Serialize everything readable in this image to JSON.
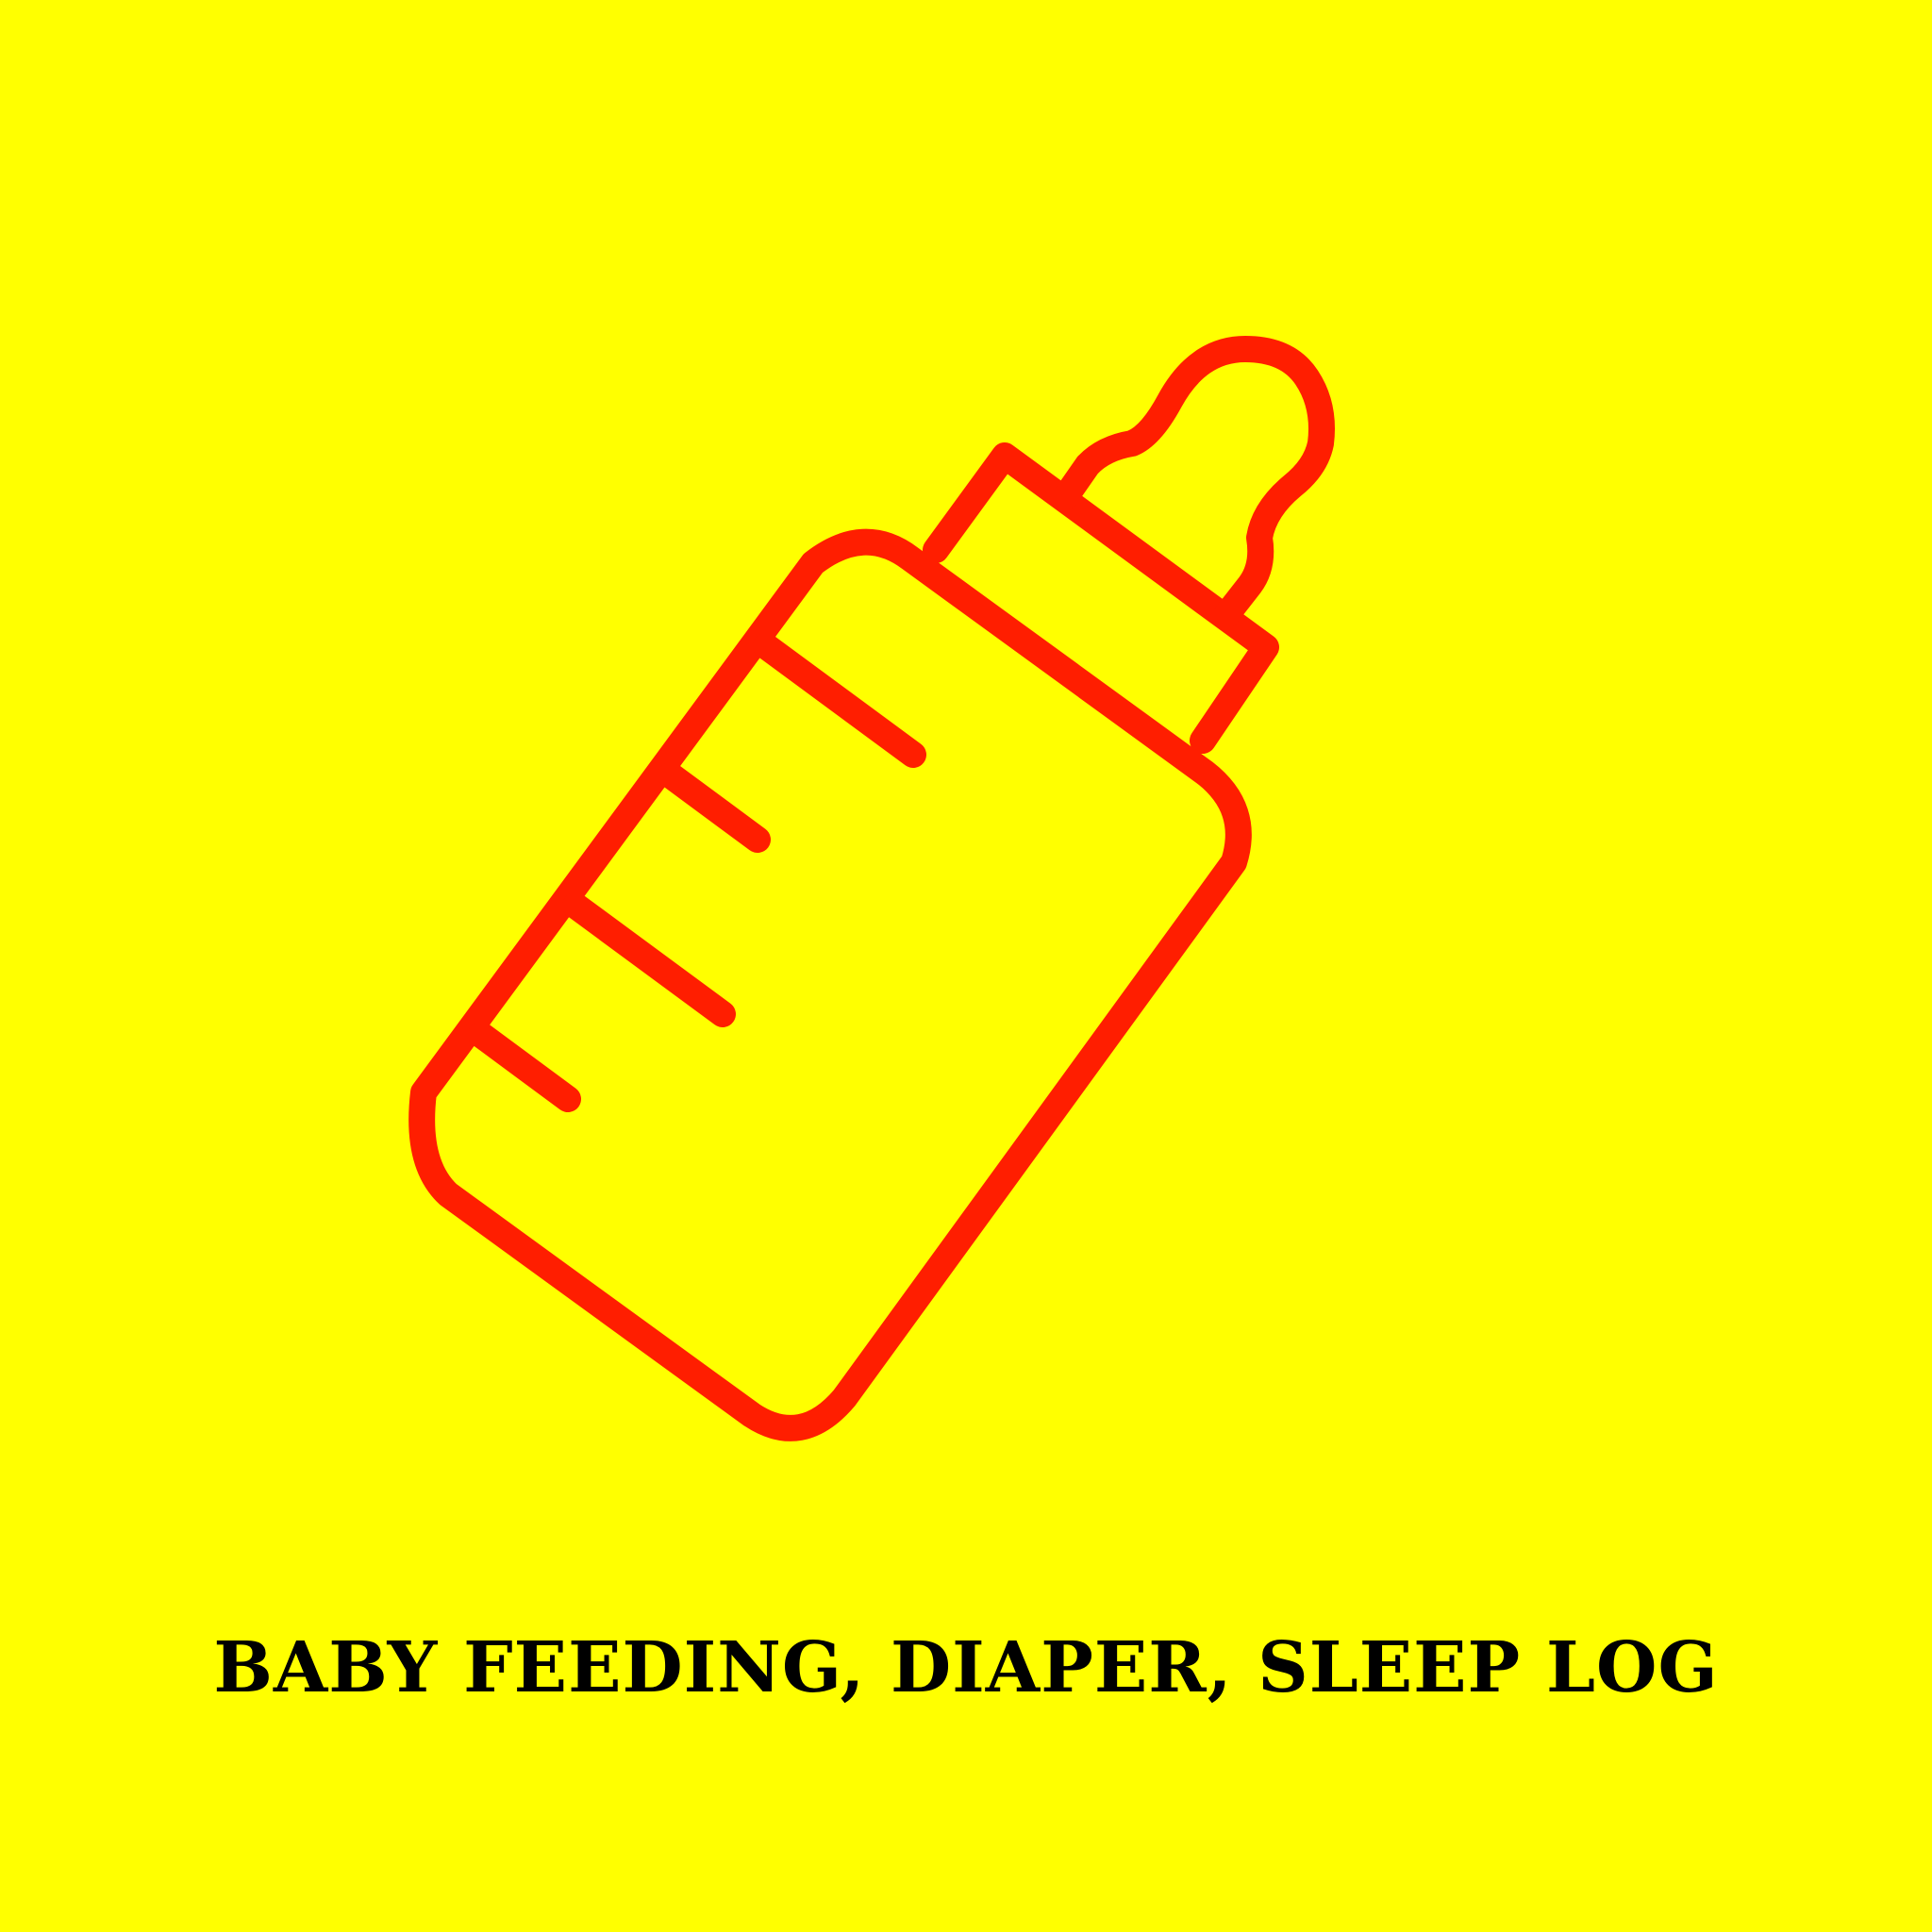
{
  "cover": {
    "title": "BABY FEEDING, DIAPER, SLEEP LOG",
    "icon": "baby-bottle-icon"
  },
  "colors": {
    "background": "#ffff00",
    "icon_stroke": "#ff1e00",
    "title_text": "#000000"
  }
}
